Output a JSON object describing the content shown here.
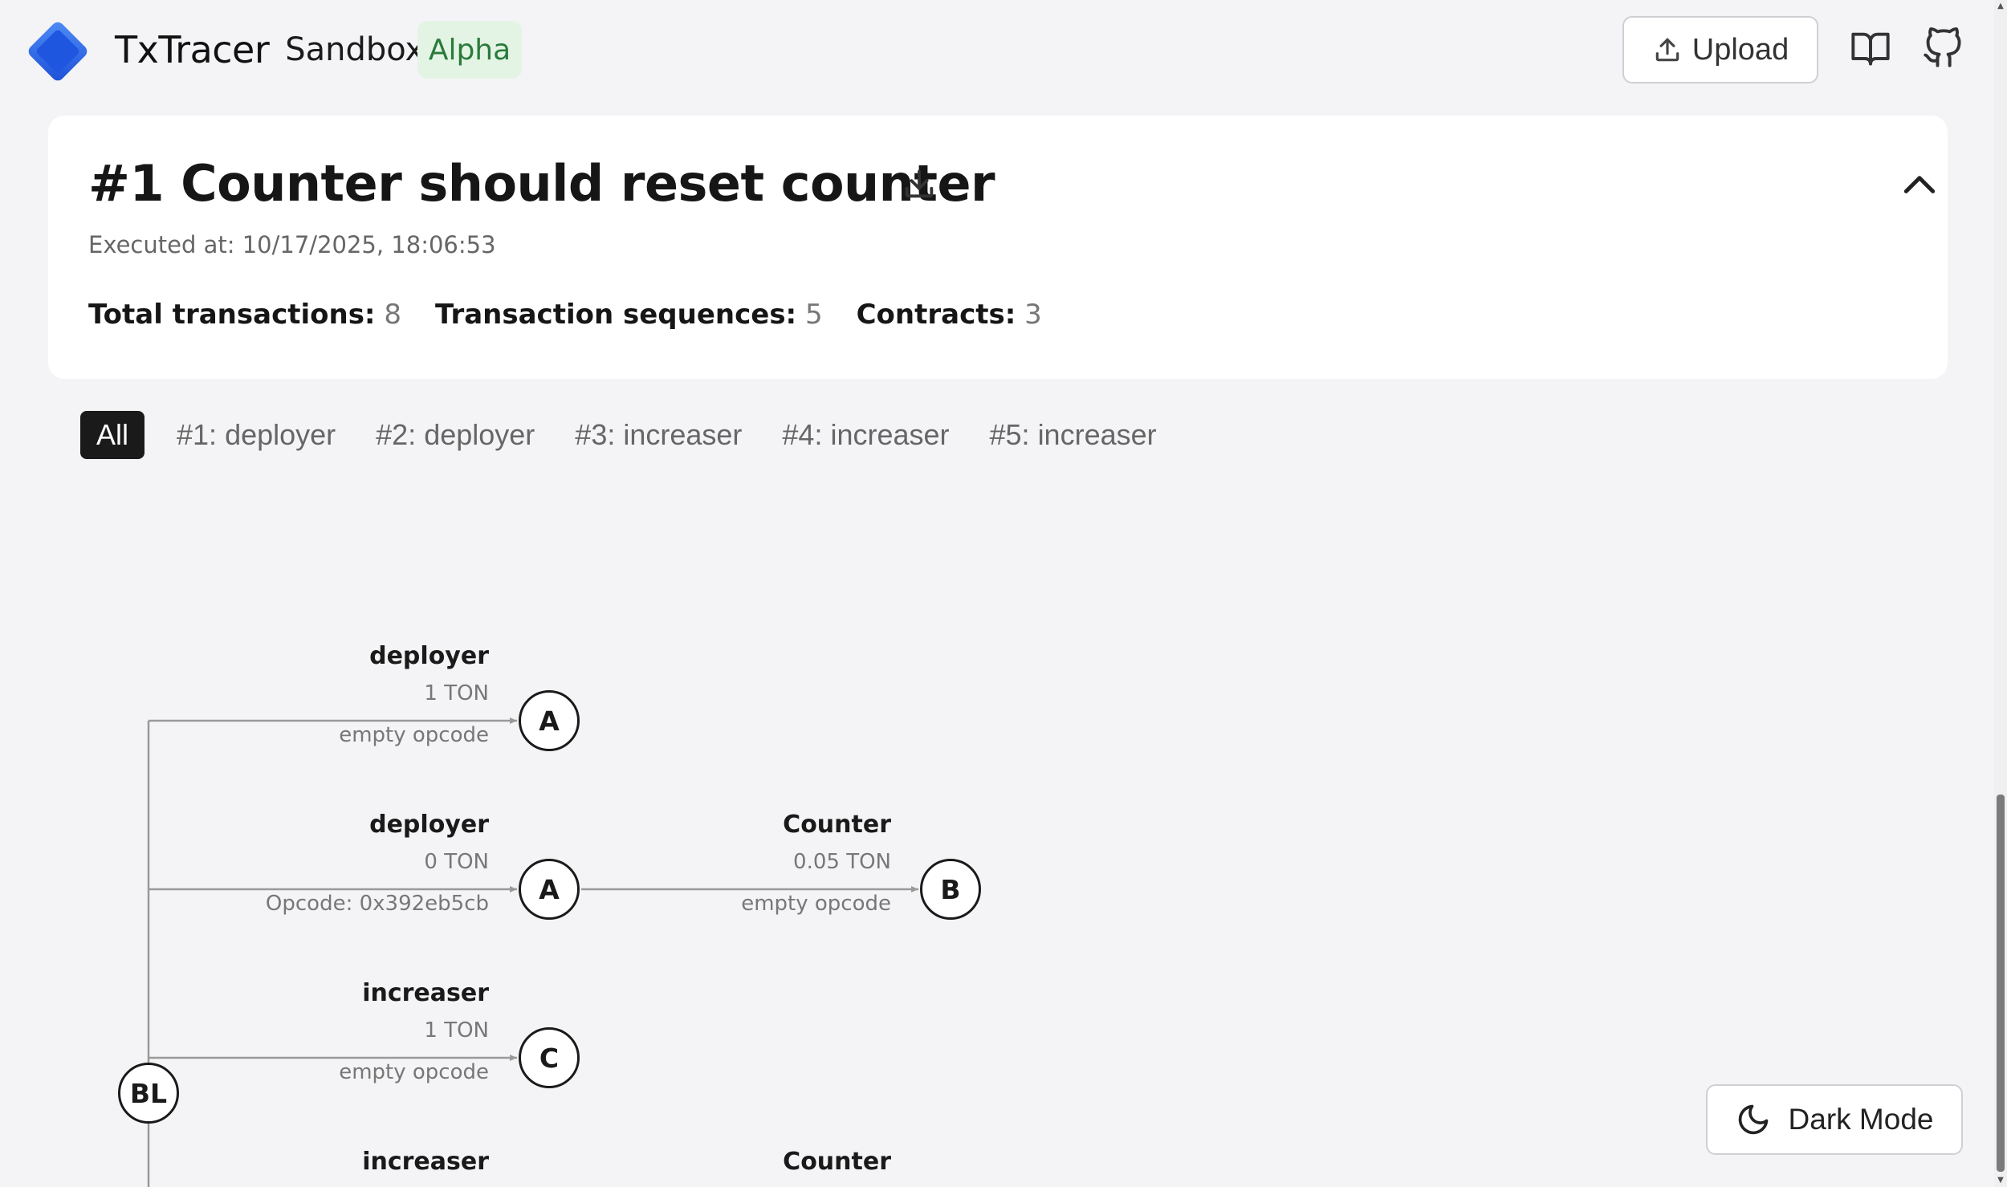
{
  "header": {
    "brand_name": "TxTracer",
    "brand_sub": "Sandbox",
    "badge": "Alpha",
    "upload_label": "Upload"
  },
  "card": {
    "title": "#1 Counter should reset counter",
    "executed_at": "Executed at: 10/17/2025, 18:06:53",
    "stats": [
      {
        "label": "Total transactions:",
        "value": "8"
      },
      {
        "label": "Transaction sequences:",
        "value": "5"
      },
      {
        "label": "Contracts:",
        "value": "3"
      }
    ]
  },
  "tabs": [
    "All",
    "#1: deployer",
    "#2: deployer",
    "#3: increaser",
    "#4: increaser",
    "#5: increaser"
  ],
  "active_tab": 0,
  "graph": {
    "root": "BL",
    "edges": [
      {
        "name": "deployer",
        "amount": "1 TON",
        "opcode": "empty opcode"
      },
      {
        "name": "deployer",
        "amount": "0 TON",
        "opcode": "Opcode: 0x392eb5cb"
      },
      {
        "name": "Counter",
        "amount": "0.05 TON",
        "opcode": "empty opcode"
      },
      {
        "name": "increaser",
        "amount": "1 TON",
        "opcode": "empty opcode"
      },
      {
        "name": "increaser",
        "amount": "",
        "opcode": ""
      },
      {
        "name": "Counter",
        "amount": "",
        "opcode": ""
      }
    ],
    "nodes": [
      "A",
      "A",
      "B",
      "C"
    ]
  },
  "dark_mode_label": "Dark Mode",
  "colors": {
    "brand_blue": "#2563eb",
    "badge_bg": "#e3f4e5",
    "badge_text": "#2a7a3b",
    "active_tab_bg": "#1a1a1a"
  }
}
